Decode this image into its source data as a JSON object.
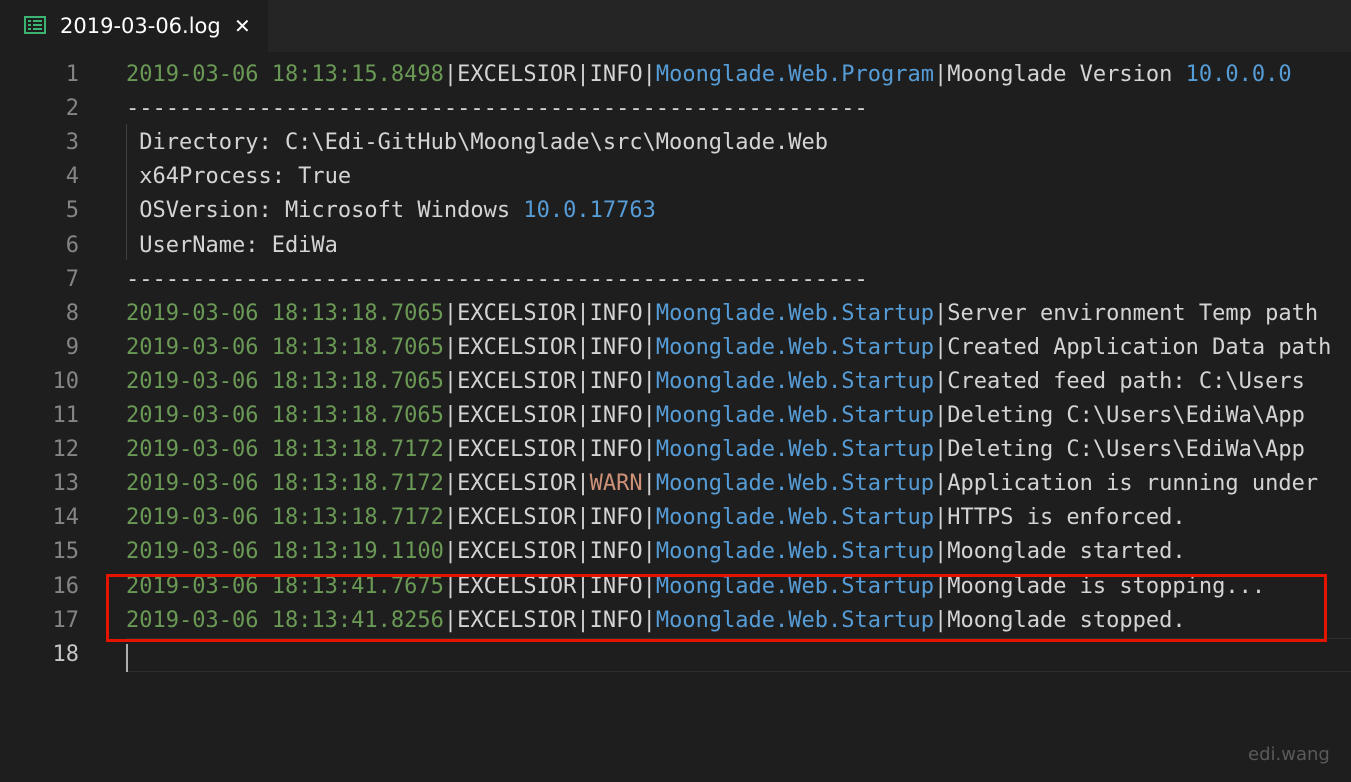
{
  "tab": {
    "title": "2019-03-06.log",
    "close_glyph": "✕",
    "icon": "log-file-icon"
  },
  "lines": [
    {
      "n": "1",
      "seg": [
        [
          "t-date",
          "2019-03-06 18:13:15.8498"
        ],
        [
          "t-default",
          "|EXCELSIOR|"
        ],
        [
          "t-default",
          "INFO"
        ],
        [
          "t-default",
          "|"
        ],
        [
          "t-blue",
          "Moonglade.Web.Program"
        ],
        [
          "t-default",
          "|Moonglade Version "
        ],
        [
          "t-num",
          "10.0.0.0"
        ]
      ]
    },
    {
      "n": "2",
      "seg": [
        [
          "t-dash",
          "--------------------------------------------------------"
        ]
      ]
    },
    {
      "n": "3",
      "seg": [
        [
          "t-default",
          " Directory: C:\\Edi-GitHub\\Moonglade\\src\\Moonglade.Web"
        ]
      ]
    },
    {
      "n": "4",
      "seg": [
        [
          "t-default",
          " x64Process: True"
        ]
      ]
    },
    {
      "n": "5",
      "seg": [
        [
          "t-default",
          " OSVersion: Microsoft Windows "
        ],
        [
          "t-num",
          "10.0.17763"
        ]
      ]
    },
    {
      "n": "6",
      "seg": [
        [
          "t-default",
          " UserName: EdiWa"
        ]
      ]
    },
    {
      "n": "7",
      "seg": [
        [
          "t-dash",
          "--------------------------------------------------------"
        ]
      ]
    },
    {
      "n": "8",
      "seg": [
        [
          "t-date",
          "2019-03-06 18:13:18.7065"
        ],
        [
          "t-default",
          "|EXCELSIOR|"
        ],
        [
          "t-default",
          "INFO"
        ],
        [
          "t-default",
          "|"
        ],
        [
          "t-blue",
          "Moonglade.Web.Startup"
        ],
        [
          "t-default",
          "|Server environment Temp path"
        ]
      ]
    },
    {
      "n": "9",
      "seg": [
        [
          "t-date",
          "2019-03-06 18:13:18.7065"
        ],
        [
          "t-default",
          "|EXCELSIOR|"
        ],
        [
          "t-default",
          "INFO"
        ],
        [
          "t-default",
          "|"
        ],
        [
          "t-blue",
          "Moonglade.Web.Startup"
        ],
        [
          "t-default",
          "|Created Application Data path"
        ]
      ]
    },
    {
      "n": "10",
      "seg": [
        [
          "t-date",
          "2019-03-06 18:13:18.7065"
        ],
        [
          "t-default",
          "|EXCELSIOR|"
        ],
        [
          "t-default",
          "INFO"
        ],
        [
          "t-default",
          "|"
        ],
        [
          "t-blue",
          "Moonglade.Web.Startup"
        ],
        [
          "t-default",
          "|Created feed path: C:\\Users"
        ]
      ]
    },
    {
      "n": "11",
      "seg": [
        [
          "t-date",
          "2019-03-06 18:13:18.7065"
        ],
        [
          "t-default",
          "|EXCELSIOR|"
        ],
        [
          "t-default",
          "INFO"
        ],
        [
          "t-default",
          "|"
        ],
        [
          "t-blue",
          "Moonglade.Web.Startup"
        ],
        [
          "t-default",
          "|Deleting C:\\Users\\EdiWa\\App"
        ]
      ]
    },
    {
      "n": "12",
      "seg": [
        [
          "t-date",
          "2019-03-06 18:13:18.7172"
        ],
        [
          "t-default",
          "|EXCELSIOR|"
        ],
        [
          "t-default",
          "INFO"
        ],
        [
          "t-default",
          "|"
        ],
        [
          "t-blue",
          "Moonglade.Web.Startup"
        ],
        [
          "t-default",
          "|Deleting C:\\Users\\EdiWa\\App"
        ]
      ]
    },
    {
      "n": "13",
      "seg": [
        [
          "t-date",
          "2019-03-06 18:13:18.7172"
        ],
        [
          "t-default",
          "|EXCELSIOR|"
        ],
        [
          "t-warn",
          "WARN"
        ],
        [
          "t-default",
          "|"
        ],
        [
          "t-blue",
          "Moonglade.Web.Startup"
        ],
        [
          "t-default",
          "|Application is running under"
        ]
      ]
    },
    {
      "n": "14",
      "seg": [
        [
          "t-date",
          "2019-03-06 18:13:18.7172"
        ],
        [
          "t-default",
          "|EXCELSIOR|"
        ],
        [
          "t-default",
          "INFO"
        ],
        [
          "t-default",
          "|"
        ],
        [
          "t-blue",
          "Moonglade.Web.Startup"
        ],
        [
          "t-default",
          "|HTTPS is enforced."
        ]
      ]
    },
    {
      "n": "15",
      "seg": [
        [
          "t-date",
          "2019-03-06 18:13:19.1100"
        ],
        [
          "t-default",
          "|EXCELSIOR|"
        ],
        [
          "t-default",
          "INFO"
        ],
        [
          "t-default",
          "|"
        ],
        [
          "t-blue",
          "Moonglade.Web.Startup"
        ],
        [
          "t-default",
          "|Moonglade started."
        ]
      ]
    },
    {
      "n": "16",
      "seg": [
        [
          "t-date",
          "2019-03-06 18:13:41.7675"
        ],
        [
          "t-default",
          "|EXCELSIOR|"
        ],
        [
          "t-default",
          "INFO"
        ],
        [
          "t-default",
          "|"
        ],
        [
          "t-blue",
          "Moonglade.Web.Startup"
        ],
        [
          "t-default",
          "|Moonglade is stopping..."
        ]
      ]
    },
    {
      "n": "17",
      "seg": [
        [
          "t-date",
          "2019-03-06 18:13:41.8256"
        ],
        [
          "t-default",
          "|EXCELSIOR|"
        ],
        [
          "t-default",
          "INFO"
        ],
        [
          "t-default",
          "|"
        ],
        [
          "t-blue",
          "Moonglade.Web.Startup"
        ],
        [
          "t-default",
          "|Moonglade stopped."
        ]
      ]
    },
    {
      "n": "18",
      "seg": []
    }
  ],
  "active_line": "18",
  "watermark": "edi.wang",
  "colors": {
    "background": "#1e1e1e",
    "timestamp": "#6a9955",
    "logger": "#569cd6",
    "warn": "#ce9178",
    "highlight_border": "#e51400"
  }
}
